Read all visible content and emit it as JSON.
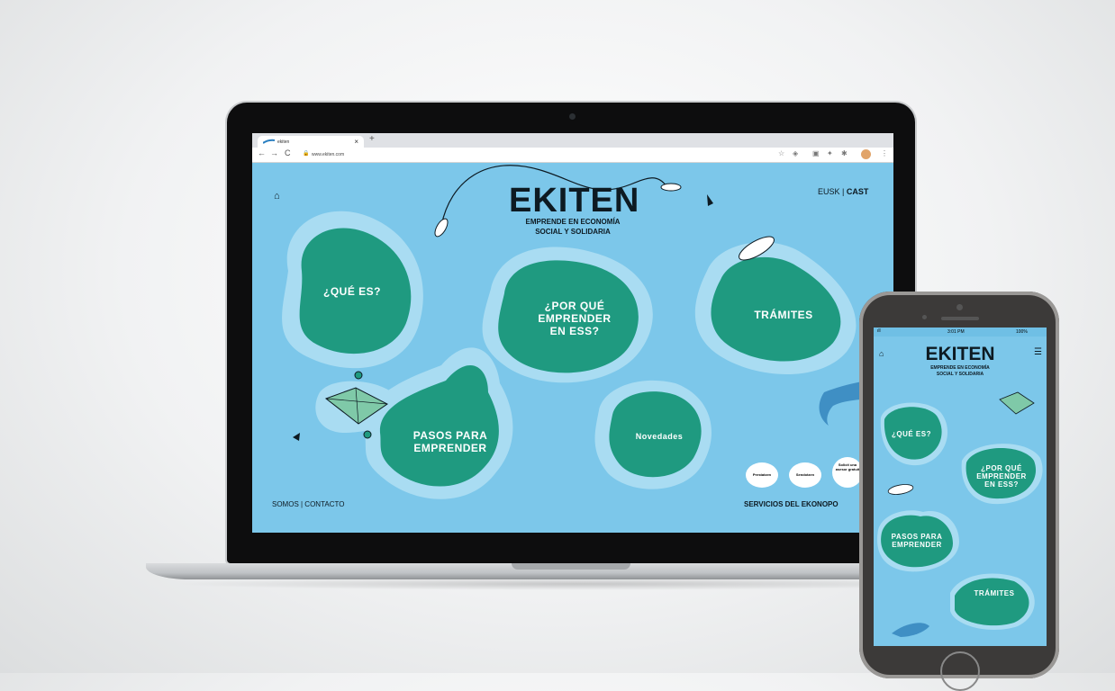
{
  "browser": {
    "tab_title": "ekiten",
    "tab_close": "×",
    "new_tab": "+",
    "url": "www.ekiten.com",
    "nav_back": "←",
    "nav_forward": "→",
    "nav_reload": "C"
  },
  "site": {
    "logo": "EKITEN",
    "tagline_line1": "EMPRENDE EN ECONOMÍA",
    "tagline_line2": "SOCIAL Y SOLIDARIA",
    "lang_eusk": "EUSK",
    "lang_sep": "|",
    "lang_cast": "CAST",
    "islands": {
      "que_es": "¿QUÉ ES?",
      "por_que_1": "¿POR QUÉ",
      "por_que_2": "EMPRENDER",
      "por_que_3": "EN ESS?",
      "tramites": "TRÁMITES",
      "pasos_1": "PASOS PARA",
      "pasos_2": "EMPRENDER",
      "novedades": "Novedades"
    },
    "footer_left": "SOMOS | CONTACTO",
    "services_title": "SERVICIOS DEL EKONOPO",
    "service_buttons": [
      "Prestatzen",
      "Sendotzen",
      "Solicit una asesor gratuit"
    ]
  },
  "phone": {
    "status_signal": "ıll",
    "status_time": "3:01 PM",
    "status_battery": "100%",
    "logo": "EKITEN",
    "tagline_line1": "EMPRENDE EN ECONOMÍA",
    "tagline_line2": "SOCIAL Y SOLIDARIA",
    "menu_icon": "☰",
    "islands": {
      "que_es": "¿QUÉ ES?",
      "por_que_1": "¿POR QUÉ",
      "por_que_2": "EMPRENDER",
      "por_que_3": "EN ESS?",
      "pasos_1": "PASOS PARA",
      "pasos_2": "EMPRENDER",
      "tramites": "TRÁMITES"
    }
  },
  "colors": {
    "sea": "#7cc7ea",
    "shallow": "#a9dcf2",
    "island": "#1f9a80",
    "ink": "#0d1a22"
  }
}
